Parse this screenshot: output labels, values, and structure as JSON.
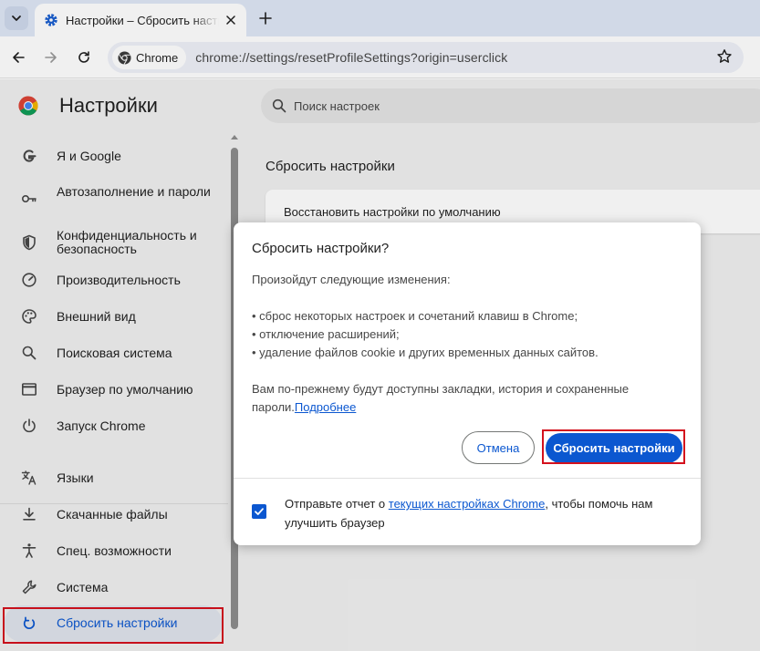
{
  "browser": {
    "tab": {
      "title": "Настройки – Сбросить настройки"
    },
    "toolbar": {
      "chip_label": "Chrome",
      "url": "chrome://settings/resetProfileSettings?origin=userclick"
    }
  },
  "settings": {
    "title": "Настройки",
    "search_placeholder": "Поиск настроек",
    "sidebar": {
      "items": [
        {
          "label": "Я и Google",
          "icon": "google-icon"
        },
        {
          "label": "Автозаполнение и пароли",
          "icon": "key-icon"
        },
        {
          "label": "Конфиденциальность и безопасность",
          "icon": "shield-icon"
        },
        {
          "label": "Производительность",
          "icon": "speedometer-icon"
        },
        {
          "label": "Внешний вид",
          "icon": "palette-icon"
        },
        {
          "label": "Поисковая система",
          "icon": "search-icon"
        },
        {
          "label": "Браузер по умолчанию",
          "icon": "browser-window-icon"
        },
        {
          "label": "Запуск Chrome",
          "icon": "power-icon"
        },
        {
          "label": "Языки",
          "icon": "translate-icon"
        },
        {
          "label": "Скачанные файлы",
          "icon": "download-icon"
        },
        {
          "label": "Спец. возможности",
          "icon": "accessibility-icon"
        },
        {
          "label": "Система",
          "icon": "wrench-icon"
        },
        {
          "label": "Сбросить настройки",
          "icon": "reset-icon"
        }
      ]
    },
    "section_title": "Сбросить настройки",
    "card_item": "Восстановить настройки по умолчанию"
  },
  "dialog": {
    "title": "Сбросить настройки?",
    "intro": "Произойдут следующие изменения:",
    "bullets": [
      "• сброс некоторых настроек и сочетаний клавиш в Chrome;",
      "• отключение расширений;",
      "• удаление файлов cookie и других временных данных сайтов."
    ],
    "note": "Вам по-прежнему будут доступны закладки, история и сохраненные пароли.",
    "learn_more": "Подробнее",
    "cancel_label": "Отмена",
    "reset_label": "Сбросить настройки",
    "report": {
      "checked": true,
      "prefix": "Отправьте отчет о ",
      "link": "текущих настройках Chrome",
      "suffix": ", чтобы помочь нам улучшить браузер"
    }
  },
  "colors": {
    "accent": "#0b57d0",
    "highlight_box": "#d4111d",
    "tabstrip": "#dfe7f6",
    "page_background": "#f0f0f0"
  }
}
